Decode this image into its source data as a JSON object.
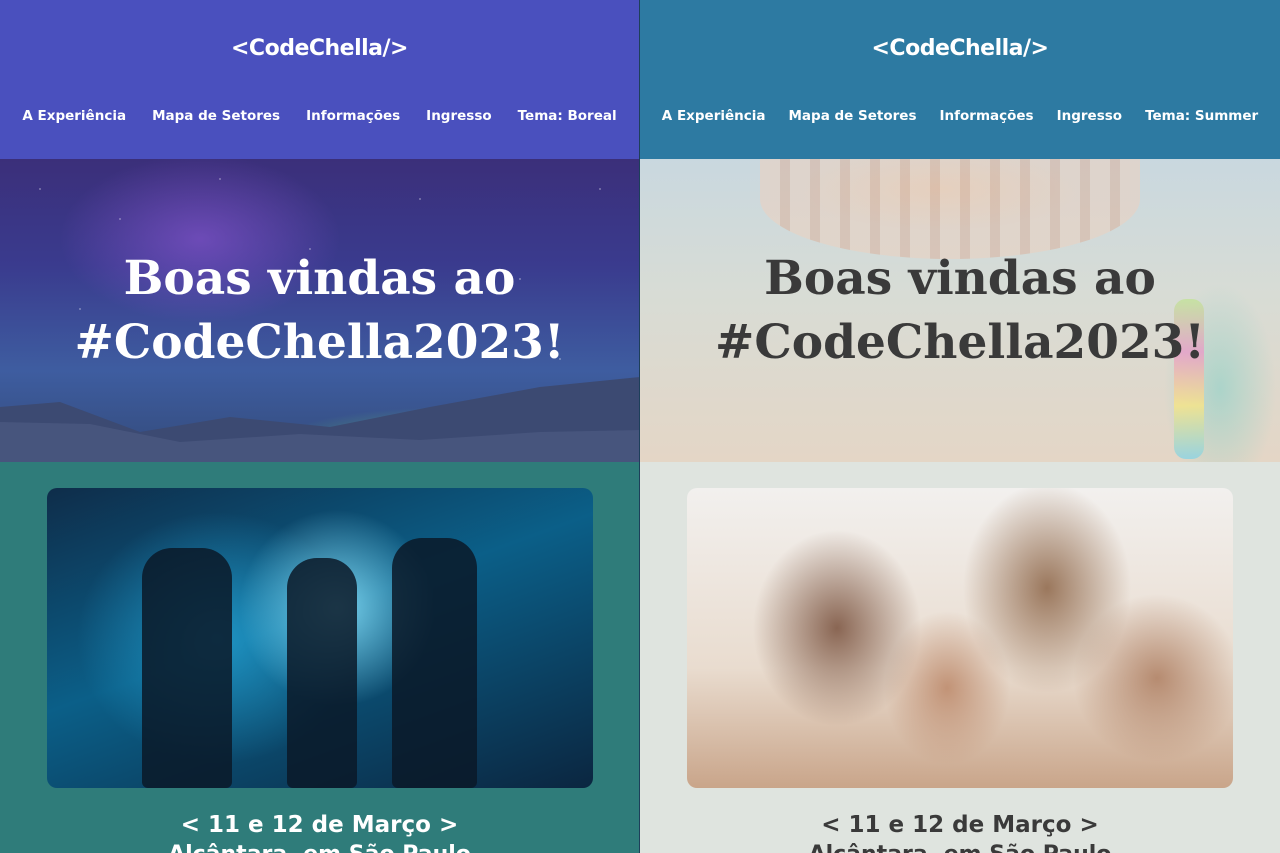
{
  "panels": [
    {
      "theme_id": "boreal",
      "logo": "<CodeChella/>",
      "nav": [
        "A Experiência",
        "Mapa de Setores",
        "Informações",
        "Ingresso",
        "Tema: Boreal"
      ],
      "hero_title_line1": "Boas vindas ao",
      "hero_title_line2": "#CodeChella2023!",
      "date": "< 11 e 12 de Março >",
      "subline": "Alcântara, em São Paulo",
      "colors": {
        "header": "#4a50be",
        "background": "#2f7c7a",
        "text": "#ffffff"
      }
    },
    {
      "theme_id": "summer",
      "logo": "<CodeChella/>",
      "nav": [
        "A Experiência",
        "Mapa de Setores",
        "Informações",
        "Ingresso",
        "Tema: Summer"
      ],
      "hero_title_line1": "Boas vindas ao",
      "hero_title_line2": "#CodeChella2023!",
      "date": "< 11 e 12 de Março >",
      "subline": "Alcântara, em São Paulo",
      "colors": {
        "header": "#2d7aa2",
        "background": "#dfe4df",
        "text": "#3a3a3a"
      }
    }
  ]
}
